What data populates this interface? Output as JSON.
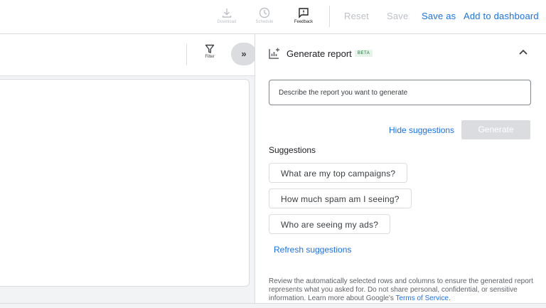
{
  "toolbar": {
    "download_label": "Download",
    "schedule_label": "Schedule",
    "feedback_label": "Feedback",
    "reset_label": "Reset",
    "save_label": "Save",
    "save_as_label": "Save as",
    "add_to_dashboard_label": "Add to dashboard"
  },
  "canvas": {
    "filter_label": "Filter",
    "expand_glyph": "»"
  },
  "panel": {
    "title": "Generate report",
    "badge": "BETA",
    "prompt_placeholder": "Describe the report you want to generate",
    "hide_suggestions_label": "Hide suggestions",
    "generate_label": "Generate",
    "suggestions_heading": "Suggestions",
    "suggestions": [
      "What are my top campaigns?",
      "How much spam am I seeing?",
      "Who are seeing my ads?"
    ],
    "refresh_label": "Refresh suggestions",
    "disclaimer_text": "Review the automatically selected rows and columns to ensure the generated report represents what you asked for. Do not share personal, confidential, or sensitive information. Learn more about Google's ",
    "terms_link": "Terms of Service",
    "disclaimer_end": "."
  },
  "colors": {
    "accent": "#1a73e8",
    "disabled": "#bdc1c6",
    "beta_bg": "#e6f4ea",
    "beta_fg": "#137333"
  }
}
